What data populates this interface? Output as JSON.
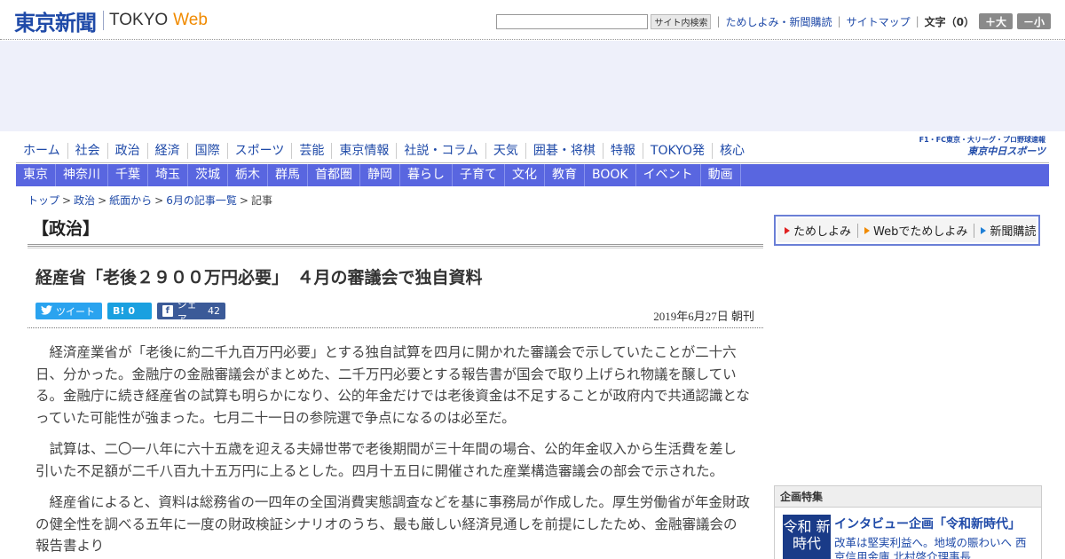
{
  "header": {
    "logo_jp": "東京新聞",
    "logo_en": "TOKYO",
    "logo_web": "Web",
    "search_button": "サイト内検索",
    "links": [
      "ためしよみ・新聞購読",
      "サイトマップ"
    ],
    "font_size_label": "文字（0）",
    "font_plus": "＋大",
    "font_minus": "－小"
  },
  "global_nav": [
    "ホーム",
    "社会",
    "政治",
    "経済",
    "国際",
    "スポーツ",
    "芸能",
    "東京情報",
    "社説・コラム",
    "天気",
    "囲碁・将棋",
    "特報",
    "TOKYO発",
    "核心"
  ],
  "promo": {
    "top": "F1・FC東京・大リーグ・プロ野球速報",
    "bottom": "東京中日スポーツ"
  },
  "region_nav": [
    "東京",
    "神奈川",
    "千葉",
    "埼玉",
    "茨城",
    "栃木",
    "群馬",
    "首都圏",
    "静岡",
    "暮らし",
    "子育て",
    "文化",
    "教育",
    "BOOK",
    "イベント",
    "動画"
  ],
  "breadcrumb": [
    "トップ",
    "政治",
    "紙面から",
    "6月の記事一覧",
    "記事"
  ],
  "section_title": "【政治】",
  "article": {
    "headline": "経産省「老後２９００万円必要」　４月の審議会で独自資料",
    "share": {
      "tweet": "ツイート",
      "hatena_icon": "B!",
      "hatena_count": "0",
      "facebook_icon": "f",
      "facebook": "シェア",
      "facebook_count": "42"
    },
    "date": "2019年6月27日 朝刊",
    "paragraphs": [
      "経済産業省が「老後に約二千九百万円必要」とする独自試算を四月に開かれた審議会で示していたことが二十六日、分かった。金融庁の金融審議会がまとめた、二千万円必要とする報告書が国会で取り上げられ物議を醸している。金融庁に続き経産省の試算も明らかになり、公的年金だけでは老後資金は不足することが政府内で共通認識となっていた可能性が強まった。七月二十一日の参院選で争点になるのは必至だ。",
      "試算は、二〇一八年に六十五歳を迎える夫婦世帯で老後期間が三十年間の場合、公的年金収入から生活費を差し引いた不足額が二千八百九十五万円に上るとした。四月十五日に開催された産業構造審議会の部会で示された。",
      "経産省によると、資料は総務省の一四年の全国消費実態調査などを基に事務局が作成した。厚生労働省が年金財政の健全性を調べる五年に一度の財政検証シナリオのうち、最も厳しい経済見通しを前提にしたため、金融審議会の報告書より"
    ]
  },
  "sidebar": {
    "links": [
      "ためしよみ",
      "Webでためしよみ",
      "新聞購読"
    ],
    "feature": {
      "head": "企画特集",
      "thumb": "令和 新時代",
      "title": "インタビュー企画「令和新時代」",
      "sub": "改革は堅実利益へ。地域の賑わいへ 西京信用金庫 北村啓介理事長"
    }
  }
}
